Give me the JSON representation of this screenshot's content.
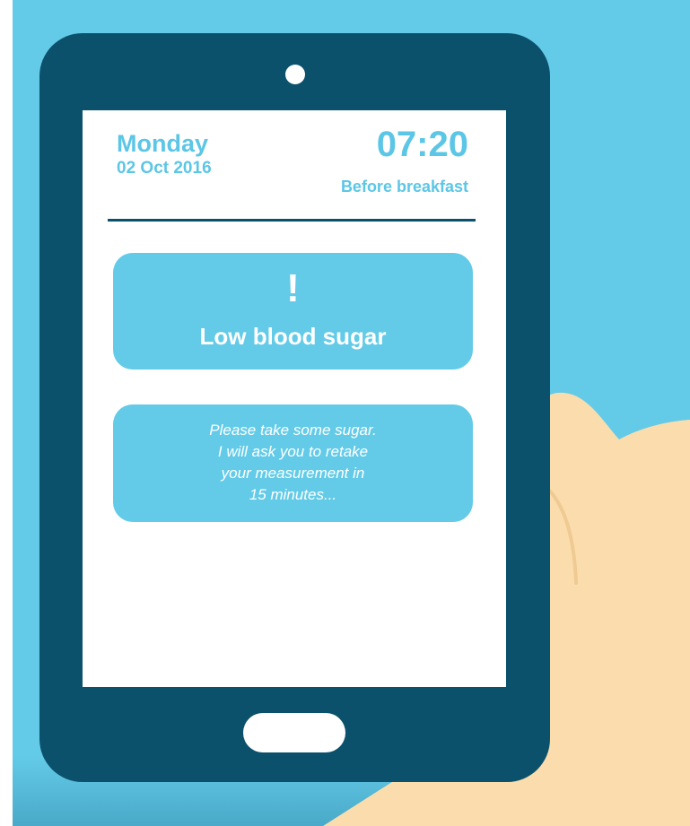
{
  "header": {
    "day": "Monday",
    "date": "02 Oct 2016",
    "time": "07:20",
    "period": "Before breakfast"
  },
  "alert": {
    "icon": "exclamation-icon",
    "symbol": "!",
    "title": "Low blood sugar"
  },
  "message": {
    "lines": [
      "Please take some sugar.",
      "I will ask you to retake",
      "your measurement in",
      "15 minutes..."
    ]
  },
  "colors": {
    "background": "#63cbe8",
    "tablet_body": "#0c516b",
    "accent": "#5cc6e6",
    "card": "#63cbe8",
    "skin": "#fbddad"
  }
}
